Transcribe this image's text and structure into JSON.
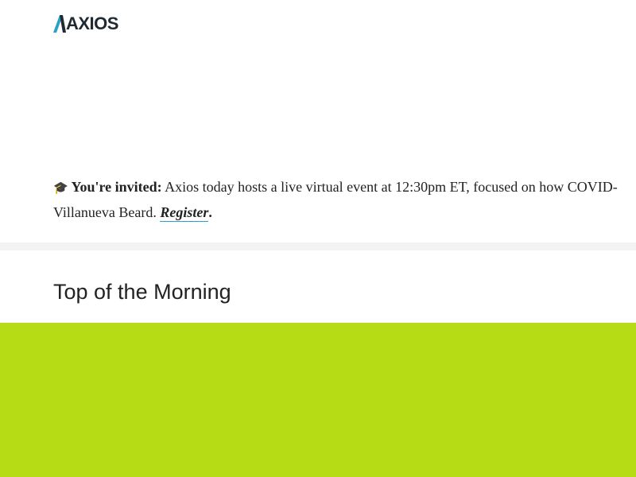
{
  "brand": {
    "logo_text": "AXIOS",
    "accent_color": "#2aa0c9",
    "logo_color": "#1f2a33"
  },
  "invite": {
    "icon": "graduation-cap-icon",
    "icon_glyph": "🎓",
    "lead": "You're invited:",
    "text_line1": " Axios today hosts a live virtual event at 12:30pm ET, focused on how COVID-",
    "text_line2": "Villanueva Beard. ",
    "link_label": "Register",
    "after_link": "."
  },
  "section": {
    "title": "Top of the Morning"
  },
  "colors": {
    "divider": "#f3f3f3",
    "hero_background": "#b6dc16",
    "text": "#222222"
  }
}
